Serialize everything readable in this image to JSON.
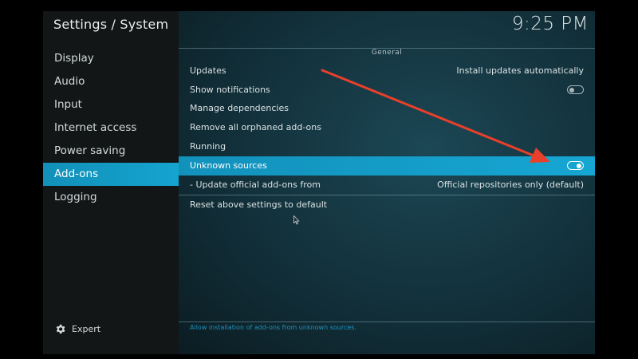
{
  "window": {
    "title": "Settings / System"
  },
  "clock": "9:25 PM",
  "sidebar": {
    "items": [
      {
        "label": "Display",
        "active": false
      },
      {
        "label": "Audio",
        "active": false
      },
      {
        "label": "Input",
        "active": false
      },
      {
        "label": "Internet access",
        "active": false
      },
      {
        "label": "Power saving",
        "active": false
      },
      {
        "label": "Add-ons",
        "active": true
      },
      {
        "label": "Logging",
        "active": false
      }
    ],
    "expert": {
      "label": "Expert",
      "icon": "gear-icon"
    }
  },
  "section": {
    "title": "General"
  },
  "settings": [
    {
      "label": "Updates",
      "value": "Install updates automatically",
      "kind": "value"
    },
    {
      "label": "Show notifications",
      "kind": "toggle",
      "state": "off"
    },
    {
      "label": "Manage dependencies",
      "kind": "action"
    },
    {
      "label": "Remove all orphaned add-ons",
      "kind": "action"
    },
    {
      "label": "Running",
      "kind": "action"
    },
    {
      "label": "Unknown sources",
      "kind": "toggle",
      "state": "on",
      "focused": true
    },
    {
      "label": "- Update official add-ons from",
      "value": "Official repositories only (default)",
      "kind": "value"
    }
  ],
  "reset": {
    "label": "Reset above settings to default"
  },
  "help": {
    "text": "Allow installation of add-ons from unknown sources."
  },
  "colors": {
    "accent": "#14a4cf",
    "arrow": "#e8402a",
    "panel": "#131617"
  }
}
